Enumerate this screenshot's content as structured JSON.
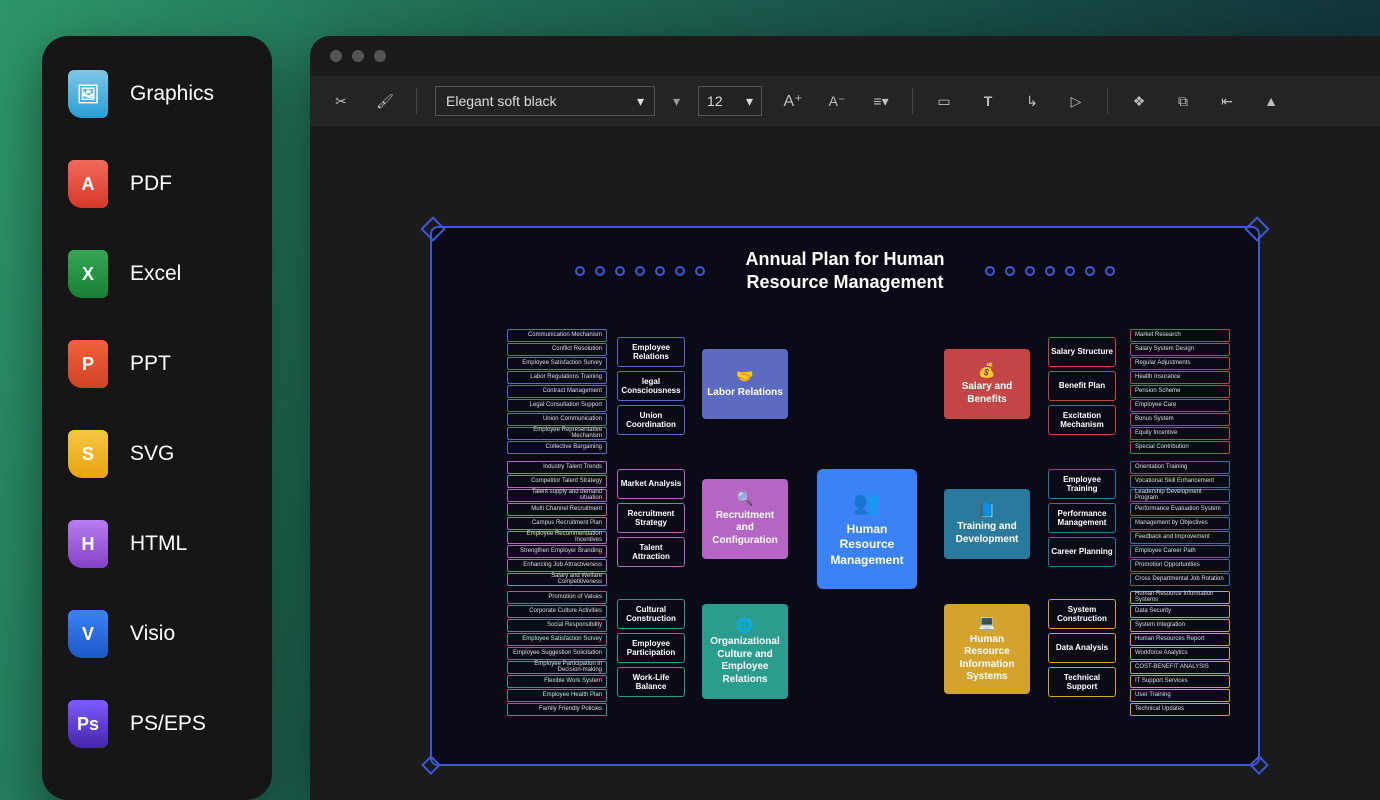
{
  "sidebar": {
    "items": [
      {
        "label": "Graphics",
        "icon": "🖼"
      },
      {
        "label": "PDF",
        "icon": "A"
      },
      {
        "label": "Excel",
        "icon": "X"
      },
      {
        "label": "PPT",
        "icon": "P"
      },
      {
        "label": "SVG",
        "icon": "S"
      },
      {
        "label": "HTML",
        "icon": "H"
      },
      {
        "label": "Visio",
        "icon": "V"
      },
      {
        "label": "PS/EPS",
        "icon": "Ps"
      }
    ]
  },
  "toolbar": {
    "font_name": "Elegant soft black",
    "font_size": "12"
  },
  "diagram": {
    "title": "Annual Plan for Human Resource Management",
    "center": "Human Resource Management",
    "branches": {
      "labor": {
        "label": "Labor Relations",
        "subs": [
          "Employee Relations",
          "legal Consciousness",
          "Union Coordination"
        ],
        "leaves": [
          "Communication Mechanism",
          "Conflict Resolution",
          "Employee Satisfaction Survey",
          "Labor Regulations Training",
          "Contract Management",
          "Legal Consultation Support",
          "Union Communication",
          "Employee Representative Mechanism",
          "Collective Bargaining"
        ]
      },
      "recruit": {
        "label": "Recruitment and Configuration",
        "subs": [
          "Market Analysis",
          "Recruitment Strategy",
          "Talent Attraction"
        ],
        "leaves": [
          "Industry Talent Trends",
          "Competitor Talent Strategy",
          "Talent supply and demand situation",
          "Multi Channel Recruitment",
          "Campus Recruitment Plan",
          "Employee Recommendation Incentives",
          "Strengthen Employer Branding",
          "Enhancing Job Attractiveness",
          "Salary and Welfare Competitiveness"
        ]
      },
      "org": {
        "label": "Organizational Culture and Employee Relations",
        "subs": [
          "Cultural Construction",
          "Employee Participation",
          "Work-Life Balance"
        ],
        "leaves": [
          "Promotion of Values",
          "Corporate Culture Activities",
          "Social Responsibility",
          "Employee Satisfaction Survey",
          "Employee Suggestion Solicitation",
          "Employee Participation in Decision-making",
          "Flexible Work System",
          "Employee Health Plan",
          "Family Friendly Policies"
        ]
      },
      "salary": {
        "label": "Salary and Benefits",
        "subs": [
          "Salary Structure",
          "Benefit Plan",
          "Excitation Mechanism"
        ],
        "leaves": [
          "Market Research",
          "Salary System Design",
          "Regular Adjustments",
          "Health Insurance",
          "Pension Scheme",
          "Employee Care",
          "Bonus System",
          "Equity Incentive",
          "Special Contribution"
        ]
      },
      "train": {
        "label": "Training and Development",
        "subs": [
          "Employee Training",
          "Performance Management",
          "Career Planning"
        ],
        "leaves": [
          "Orientation Training",
          "Vocational Skill Enhancement",
          "Leadership Development Program",
          "Performance Evaluation System",
          "Management by Objectives",
          "Feedback and Improvement",
          "Employee Career Path",
          "Promotion Opportunities",
          "Cross Departmental Job Rotation"
        ]
      },
      "hris": {
        "label": "Human Resource Information Systems",
        "subs": [
          "System Construction",
          "Data Analysis",
          "Technical Support"
        ],
        "leaves": [
          "Human Resource Information Systems",
          "Data Security",
          "System Integration",
          "Human Resources Report",
          "Workforce Analytics",
          "COST-BENEFIT ANALYSIS",
          "IT Support Services",
          "User Training",
          "Technical Updates"
        ]
      }
    }
  }
}
